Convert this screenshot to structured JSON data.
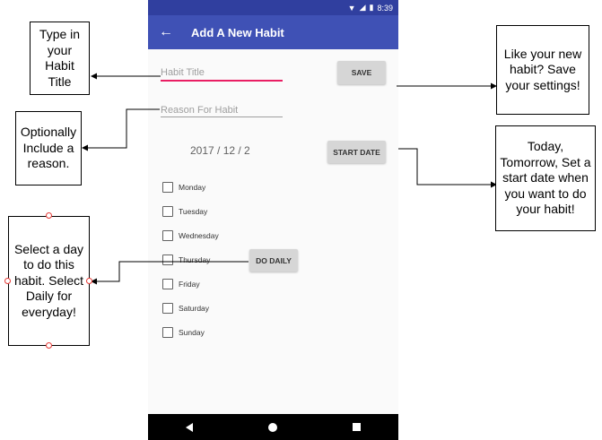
{
  "status_bar": {
    "time": "8:39"
  },
  "app_bar": {
    "title": "Add A New Habit",
    "back_icon": "arrow-left-icon"
  },
  "form": {
    "habit_title_placeholder": "Habit Title",
    "reason_placeholder": "Reason For Habit",
    "save_label": "SAVE",
    "date_value": "2017 / 12 / 2",
    "start_date_label": "START DATE",
    "do_daily_label": "DO DAILY",
    "days": [
      "Monday",
      "Tuesday",
      "Wednesday",
      "Thursday",
      "Friday",
      "Saturday",
      "Sunday"
    ]
  },
  "annotations": {
    "title_note": "Type in your Habit Title",
    "reason_note": "Optionally Include a reason.",
    "days_note": "Select a day to do this habit. Select Daily for everyday!",
    "save_note": "Like your new habit? Save your settings!",
    "start_note": "Today, Tomorrow, Set a start date when you want to do your habit!"
  },
  "colors": {
    "primary": "#3f51b5",
    "primary_dark": "#303f9f",
    "accent": "#e91e63"
  }
}
